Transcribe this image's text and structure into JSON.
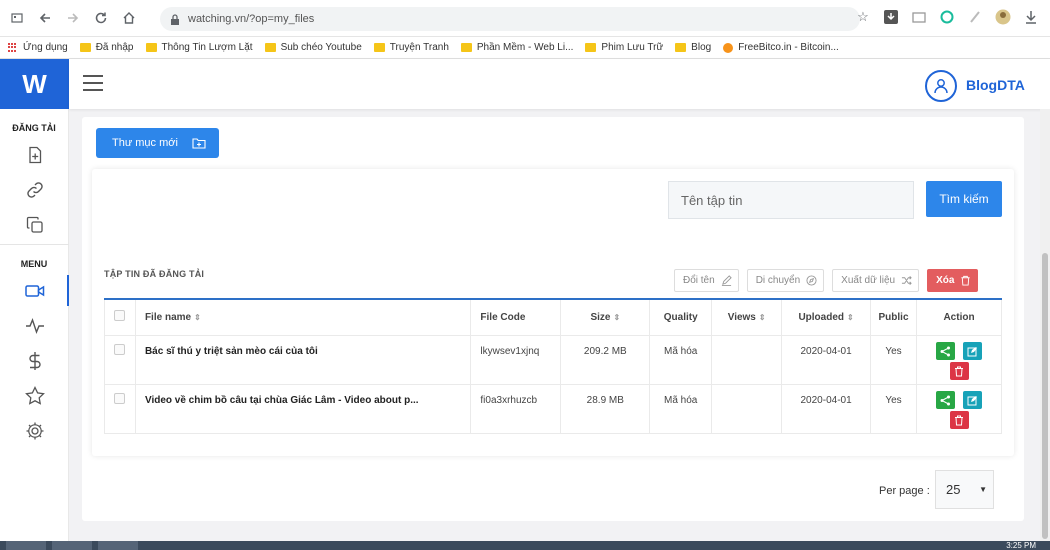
{
  "browser": {
    "url": "watching.vn/?op=my_files",
    "bookmarks": [
      {
        "label": "Ứng dụng",
        "kind": "apps"
      },
      {
        "label": "Đã nhập",
        "kind": "folder"
      },
      {
        "label": "Thông Tin Lượm Lặt",
        "kind": "folder"
      },
      {
        "label": "Sub chéo Youtube",
        "kind": "folder"
      },
      {
        "label": "Truyện Tranh",
        "kind": "folder"
      },
      {
        "label": "Phần Mềm - Web Li...",
        "kind": "folder"
      },
      {
        "label": "Phim Lưu Trữ",
        "kind": "folder"
      },
      {
        "label": "Blog",
        "kind": "folder"
      },
      {
        "label": "FreeBitco.in - Bitcoin...",
        "kind": "coin"
      }
    ]
  },
  "logo": {
    "text": "W"
  },
  "sidebar": {
    "upload_section": "ĐĂNG TẢI",
    "menu_section": "MENU",
    "upload_items": [
      "file-plus-icon",
      "link-icon",
      "copy-icon"
    ],
    "menu_items": [
      "video-icon",
      "activity-icon",
      "dollar-icon",
      "star-icon",
      "settings-icon"
    ]
  },
  "header": {
    "username": "BlogDTA"
  },
  "toolbar": {
    "new_folder_label": "Thư mục mới"
  },
  "search": {
    "placeholder": "Tên tập tin",
    "button_label": "Tìm kiếm"
  },
  "files_section": {
    "title": "TẬP TIN ĐÃ ĐĂNG TẢI",
    "rename_label": "Đổi tên",
    "move_label": "Di chuyển",
    "export_label": "Xuất dữ liệu",
    "delete_label": "Xóa"
  },
  "table": {
    "columns": {
      "file_name": "File name",
      "file_code": "File Code",
      "size": "Size",
      "quality": "Quality",
      "views": "Views",
      "uploaded": "Uploaded",
      "public": "Public",
      "action": "Action"
    },
    "rows": [
      {
        "file_name": "Bác sĩ thú y triệt sản mèo cái của tôi",
        "file_code": "lkywsev1xjnq",
        "size": "209.2 MB",
        "quality": "Mã hóa",
        "views": "",
        "uploaded": "2020-04-01",
        "public": "Yes"
      },
      {
        "file_name": "Video về chim bồ câu tại chùa Giác Lâm - Video about p...",
        "file_code": "fi0a3xrhuzcb",
        "size": "28.9 MB",
        "quality": "Mã hóa",
        "views": "",
        "uploaded": "2020-04-01",
        "public": "Yes"
      }
    ]
  },
  "pagination": {
    "per_page_label": "Per page :",
    "per_page_value": "25"
  },
  "taskbar": {
    "clock": "3:25 PM"
  },
  "colors": {
    "primary": "#1f64d7",
    "button": "#2d86ea",
    "danger": "#e35d5f",
    "share": "#28a745",
    "edit": "#17a2b8",
    "delete": "#dc3545"
  }
}
